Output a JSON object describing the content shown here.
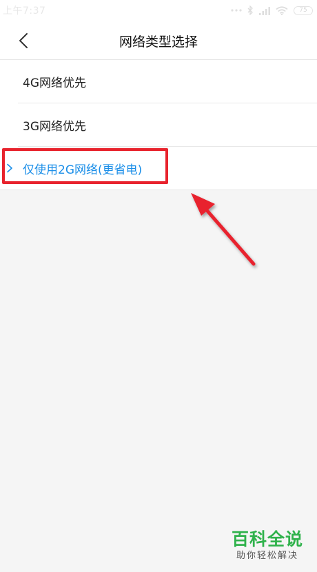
{
  "status_bar": {
    "time": "上午7:37",
    "battery": "75",
    "icons": [
      "more-dots-icon",
      "bluetooth-icon",
      "signal-icon",
      "wifi-icon",
      "battery-icon"
    ]
  },
  "header": {
    "title": "网络类型选择",
    "back_icon": "chevron-left-icon"
  },
  "options": [
    {
      "label": "4G网络优先",
      "selected": false
    },
    {
      "label": "3G网络优先",
      "selected": false
    },
    {
      "label": "仅使用2G网络(更省电)",
      "selected": true
    }
  ],
  "colors": {
    "accent": "#1a8ee8",
    "highlight": "#e8232d",
    "watermark": "#2fb24b",
    "background": "#f5f5f5"
  },
  "watermark": {
    "title": "百科全说",
    "subtitle": "助你轻松解决"
  }
}
